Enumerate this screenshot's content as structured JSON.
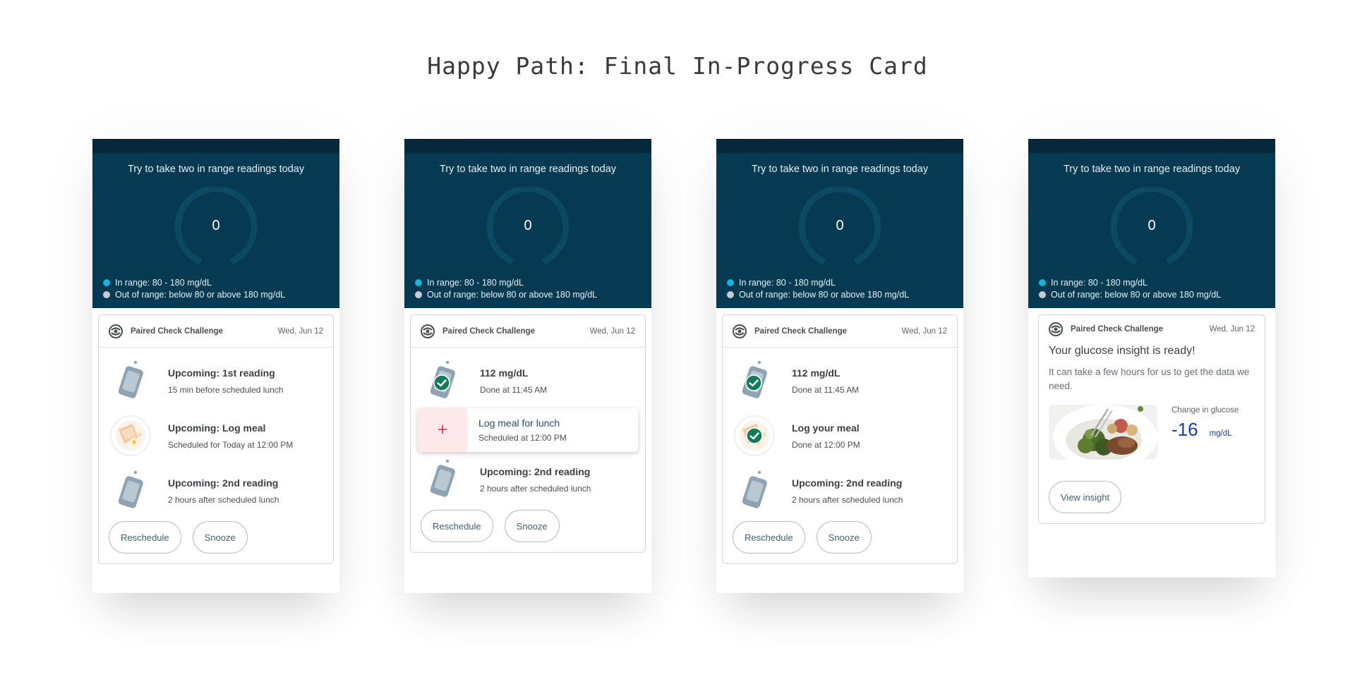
{
  "page": {
    "title": "Happy Path: Final In-Progress Card"
  },
  "colors": {
    "hero_bg": "#053a52",
    "status_strip": "#05283a",
    "in_range_dot": "#12b6d9",
    "out_range_dot": "#c8ccd0",
    "check_green": "#137a5a",
    "accent_blue": "#1e3fa0",
    "plus_red": "#d8345f"
  },
  "screens": [
    {
      "hero": {
        "goal": "Try to take two in range readings today",
        "count": "0",
        "legend_in": "In range: 80 - 180 mg/dL",
        "legend_out": "Out of range: below 80 or above 180 mg/dL"
      },
      "card": {
        "title": "Paired Check Challenge",
        "date": "Wed, Jun 12",
        "steps": [
          {
            "icon": "glucose-meter-icon",
            "title": "Upcoming: 1st reading",
            "sub": "15 min before scheduled lunch"
          },
          {
            "icon": "meal-icon",
            "title": "Upcoming: Log meal",
            "sub": "Scheduled for Today at 12:00 PM"
          },
          {
            "icon": "glucose-meter-icon",
            "title": "Upcoming: 2nd reading",
            "sub": "2 hours after scheduled lunch"
          }
        ],
        "buttons": {
          "reschedule": "Reschedule",
          "snooze": "Snooze"
        }
      }
    },
    {
      "hero": {
        "goal": "Try to take two in range readings today",
        "count": "0",
        "legend_in": "In range: 80 - 180 mg/dL",
        "legend_out": "Out of range: below 80 or above 180 mg/dL"
      },
      "card": {
        "title": "Paired Check Challenge",
        "date": "Wed, Jun 12",
        "steps": [
          {
            "icon": "glucose-meter-checked-icon",
            "title": "112 mg/dL",
            "sub": "Done at 11:45 AM"
          },
          {
            "icon": "plus-icon",
            "title": "Log meal for lunch",
            "sub": "Scheduled at 12:00 PM"
          },
          {
            "icon": "glucose-meter-icon",
            "title": "Upcoming: 2nd reading",
            "sub": "2 hours after scheduled lunch"
          }
        ],
        "buttons": {
          "reschedule": "Reschedule",
          "snooze": "Snooze"
        }
      }
    },
    {
      "hero": {
        "goal": "Try to take two in range readings today",
        "count": "0",
        "legend_in": "In range: 80 - 180 mg/dL",
        "legend_out": "Out of range: below 80 or above 180 mg/dL"
      },
      "card": {
        "title": "Paired Check Challenge",
        "date": "Wed, Jun 12",
        "steps": [
          {
            "icon": "glucose-meter-checked-icon",
            "title": "112 mg/dL",
            "sub": "Done at 11:45 AM"
          },
          {
            "icon": "meal-checked-icon",
            "title": "Log your meal",
            "sub": "Done at 12:00 PM"
          },
          {
            "icon": "glucose-meter-icon",
            "title": "Upcoming: 2nd reading",
            "sub": "2 hours after scheduled lunch"
          }
        ],
        "buttons": {
          "reschedule": "Reschedule",
          "snooze": "Snooze"
        }
      }
    },
    {
      "hero": {
        "goal": "Try to take two in range readings today",
        "count": "0",
        "legend_in": "In range: 80 - 180 mg/dL",
        "legend_out": "Out of range: below 80 or above 180 mg/dL"
      },
      "card": {
        "title": "Paired Check Challenge",
        "date": "Wed, Jun 12",
        "insight": {
          "heading": "Your glucose insight is ready!",
          "body": "It can take a few hours for us to get the data we need.",
          "change_label": "Change in glucose",
          "change_value": "-16",
          "change_unit": "mg/dL",
          "image_icon": "meal-photo"
        },
        "buttons": {
          "view": "View insight"
        }
      }
    }
  ]
}
